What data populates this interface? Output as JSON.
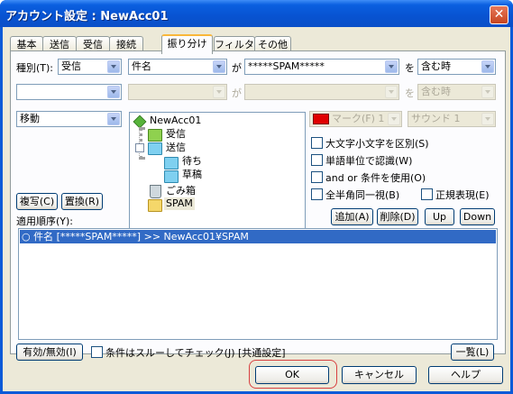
{
  "window": {
    "title": "アカウント設定 : NewAcc01",
    "close_glyph": "✕"
  },
  "tabs": [
    {
      "label": "基本"
    },
    {
      "label": "送信"
    },
    {
      "label": "受信"
    },
    {
      "label": "接続"
    },
    {
      "label": "振り分け"
    },
    {
      "label": "フィルタ"
    },
    {
      "label": "その他"
    }
  ],
  "rule": {
    "type_label": "種別(T):",
    "type_value": "受信",
    "field_value": "件名",
    "ga": "が",
    "pattern_value": "*****SPAM*****",
    "wo": "を",
    "cond_value": "含む時",
    "row2_ga": "が",
    "row2_wo": "を",
    "row2_cond": "含む時",
    "action_value": "移動",
    "mark_value": "マーク(F) 1",
    "sound_value": "サウンド 1",
    "mark_color": "#e00000"
  },
  "tree": {
    "root": "NewAcc01",
    "items": [
      "受信",
      "送信",
      "待ち",
      "草稿",
      "ごみ箱",
      "SPAM"
    ]
  },
  "options": {
    "case": "大文字小文字を区別(S)",
    "word": "単語単位で認識(W)",
    "andor": "and or 条件を使用(O)",
    "fullhalf": "全半角同一視(B)",
    "regex": "正規表現(E)"
  },
  "buttons": {
    "copy": "複写(C)",
    "replace": "置換(R)",
    "add": "追加(A)",
    "delete": "削除(D)",
    "up": "Up",
    "down": "Down",
    "toggle": "有効/無効(I)",
    "list": "一覧(L)",
    "ok": "OK",
    "cancel": "キャンセル",
    "help": "ヘルプ"
  },
  "order": {
    "label": "適用順序(Y):",
    "rows": [
      "○ 件名 [*****SPAM*****]  >>  NewAcc01¥SPAM"
    ]
  },
  "skip_check": "条件はスルーしてチェック(J) [共通設定]"
}
